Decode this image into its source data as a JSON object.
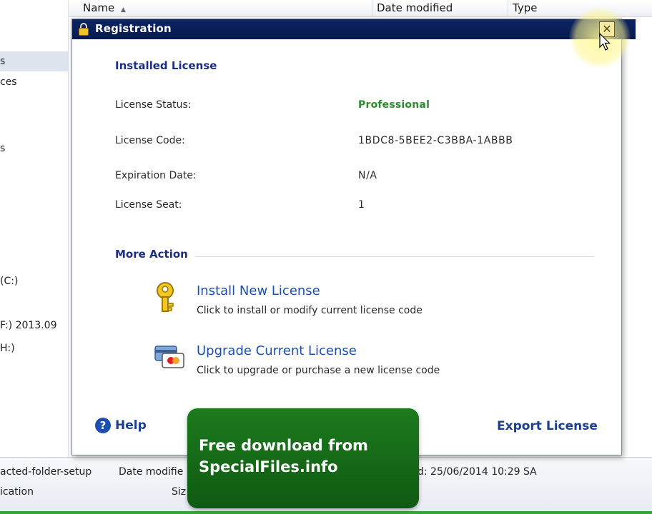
{
  "explorer": {
    "columns": {
      "name": "Name",
      "date_modified": "Date modified",
      "type": "Type"
    },
    "nav_items": [
      "s",
      "ces",
      "s",
      "(C:)",
      "F:) 2013.09",
      "H:)"
    ],
    "details": {
      "filename": "acted-folder-setup",
      "date_label": "Date modifie",
      "date_value": "d: 25/06/2014 10:29 SA",
      "type_value": "ication",
      "size_label": "Siz"
    }
  },
  "dialog": {
    "title": "Registration",
    "close_label": "✕",
    "installed_license": {
      "heading": "Installed License",
      "rows": [
        {
          "label": "License Status:",
          "value": "Professional"
        },
        {
          "label": "License Code:",
          "value": "1BDC8-5BEE2-C3BBA-1ABBB"
        },
        {
          "label": "Expiration Date:",
          "value": "N/A"
        },
        {
          "label": "License Seat:",
          "value": "1"
        }
      ]
    },
    "more_action": {
      "heading": "More Action",
      "actions": [
        {
          "title": "Install New License",
          "desc": "Click to install or modify current license code",
          "icon": "key-icon"
        },
        {
          "title": "Upgrade Current License",
          "desc": "Click to upgrade or purchase a new license code",
          "icon": "cards-icon"
        }
      ]
    },
    "help_label": "Help",
    "export_label": "Export License"
  },
  "watermark": {
    "line1": "Free download from",
    "line2": "SpecialFiles.info"
  },
  "colors": {
    "titlebar": "#0d2463",
    "heading": "#1a2e82",
    "link": "#1c4fb0",
    "status_pro": "#2e8b2e",
    "watermark": "#1d7a1d"
  }
}
